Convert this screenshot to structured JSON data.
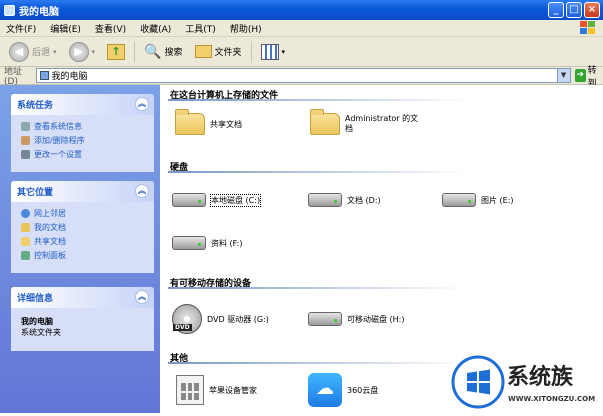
{
  "window": {
    "title": "我的电脑"
  },
  "menu": [
    "文件(F)",
    "编辑(E)",
    "查看(V)",
    "收藏(A)",
    "工具(T)",
    "帮助(H)"
  ],
  "toolbar": {
    "back": "后退",
    "search": "搜索",
    "folders": "文件夹"
  },
  "address": {
    "label": "地址(D)",
    "value": "我的电脑",
    "go": "转到"
  },
  "panels": {
    "tasks": {
      "title": "系统任务",
      "items": [
        "查看系统信息",
        "添加/删除程序",
        "更改一个设置"
      ]
    },
    "places": {
      "title": "其它位置",
      "items": [
        "网上邻居",
        "我的文档",
        "共享文档",
        "控制面板"
      ]
    },
    "details": {
      "title": "详细信息",
      "name": "我的电脑",
      "sub": "系统文件夹"
    }
  },
  "groups": {
    "stored": "在这台计算机上存储的文件",
    "hard": "硬盘",
    "removable": "有可移动存储的设备",
    "other": "其他"
  },
  "items": {
    "shared": "共享文档",
    "admin": "Administrator 的文档",
    "drive_c": "本地磁盘 (C:)",
    "drive_d": "文档 (D:)",
    "drive_e": "图片 (E:)",
    "drive_f": "资料 (F:)",
    "dvd": "DVD 驱动器 (G:)",
    "removable": "可移动磁盘 (H:)",
    "apple": "苹果设备管家",
    "cloud": "360云盘"
  },
  "watermark": {
    "brand": "系统族",
    "url": "WWW.XITONGZU.COM"
  },
  "colors": {
    "title_bar": "#0a57d6",
    "task_pane": "#6f8ddf",
    "panel_header": "#215dc6"
  }
}
